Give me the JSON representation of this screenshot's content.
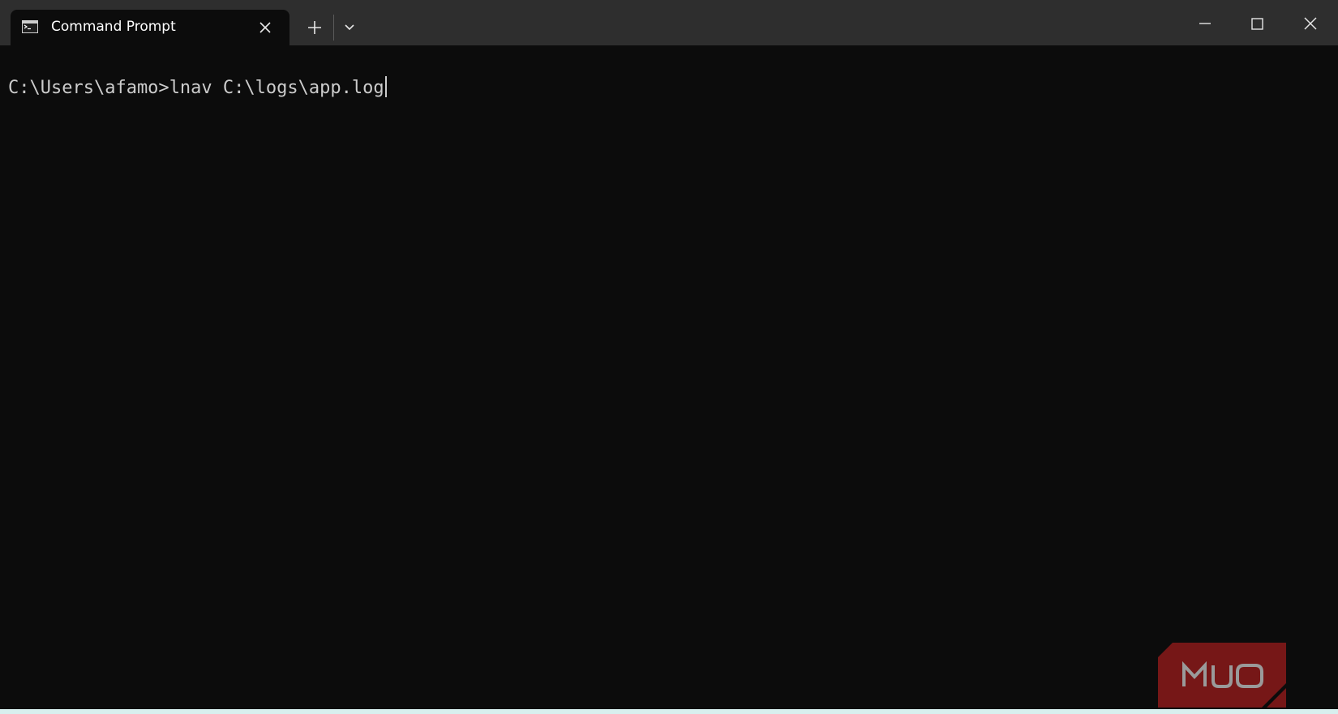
{
  "window": {
    "tab": {
      "title": "Command Prompt",
      "icon": "console-icon",
      "close_icon": "close-icon"
    },
    "new_tab_icon": "plus-icon",
    "dropdown_icon": "chevron-down-icon",
    "caption_buttons": [
      "minimize-icon",
      "maximize-icon",
      "close-icon"
    ]
  },
  "terminal": {
    "prompt": "C:\\Users\\afamo>",
    "command": "lnav C:\\logs\\app.log"
  },
  "watermark": {
    "text": "MUO",
    "color": "#8a1a1a"
  },
  "colors": {
    "titlebar": "#2e2e2e",
    "terminal_bg": "#0c0c0c",
    "terminal_fg": "#cccccc"
  }
}
